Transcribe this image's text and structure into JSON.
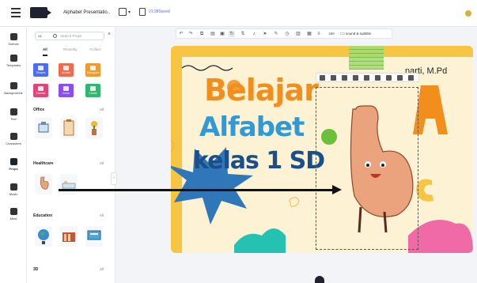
{
  "header": {
    "title": "Alphabet Presentatio..",
    "saved_status": "21:28Saved"
  },
  "rail": {
    "items": [
      {
        "label": "Scenes"
      },
      {
        "label": "Templates"
      },
      {
        "label": "Backgrounds"
      },
      {
        "label": "Text"
      },
      {
        "label": "Characters"
      },
      {
        "label": "Props",
        "active": true
      },
      {
        "label": "Music"
      },
      {
        "label": "Mine"
      }
    ]
  },
  "panel": {
    "filter": "All",
    "search_placeholder": "Search Props",
    "tabs": [
      "All",
      "Recently",
      "Collect"
    ],
    "categories": [
      {
        "label": "Shapes",
        "color": "#4a6cf7"
      },
      {
        "label": "Arrows",
        "color": "#f06a4d"
      },
      {
        "label": "Dialogues",
        "color": "#f39a2c"
      },
      {
        "label": "Frames",
        "color": "#e2447a"
      },
      {
        "label": "Icons",
        "color": "#8a4df0"
      },
      {
        "label": "Charts",
        "color": "#2fb86d"
      }
    ],
    "sections": [
      {
        "title": "Office",
        "all": "All"
      },
      {
        "title": "Healthcare",
        "all": "All"
      },
      {
        "title": "Education",
        "all": "All"
      },
      {
        "title": "3D",
        "all": "All"
      }
    ]
  },
  "toolbar": {
    "zoom_value": "189",
    "sound_label": "sound & subtitle"
  },
  "slide": {
    "line1": "Belajar",
    "line2": "Alfabet",
    "line3": "kelas 1 SD",
    "author": "narti, M.Pd",
    "letter_a": "A",
    "letter_c": "C"
  }
}
